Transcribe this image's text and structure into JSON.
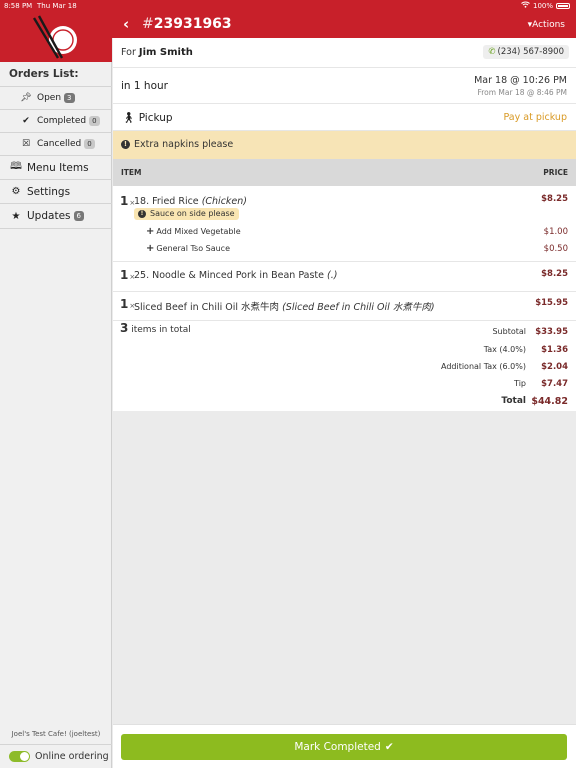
{
  "status_bar": {
    "time": "8:58 PM",
    "date": "Thu Mar 18",
    "battery": "100%"
  },
  "sidebar": {
    "orders_title": "Orders List:",
    "open": {
      "label": "Open",
      "count": "3"
    },
    "completed": {
      "label": "Completed",
      "count": "0"
    },
    "cancelled": {
      "label": "Cancelled",
      "count": "0"
    },
    "menu_items": "Menu Items",
    "settings": "Settings",
    "updates": {
      "label": "Updates",
      "count": "6"
    },
    "cafe_name": "Joel's Test Cafe! (joeltest)",
    "online_ordering": "Online ordering"
  },
  "header": {
    "order_prefix": "#",
    "order_number": "23931963",
    "actions": "Actions"
  },
  "order": {
    "for_prefix": "For",
    "customer": "Jim Smith",
    "phone": "(234) 567-8900",
    "eta": "in 1 hour",
    "date": "Mar 18 @ 10:26 PM",
    "date_from": "From Mar 18 @ 8:46 PM",
    "mode": "Pickup",
    "payment": "Pay at pickup",
    "note": "Extra napkins please"
  },
  "table_header": {
    "item": "ITEM",
    "price": "PRICE"
  },
  "items": [
    {
      "qty": "1",
      "x": "×",
      "name": "18. Fried Rice",
      "variant": "(Chicken)",
      "price": "$8.25",
      "note": "Sauce on side please",
      "modifiers": [
        {
          "plus": "+",
          "name": "Add Mixed Vegetable",
          "price": "$1.00"
        },
        {
          "plus": "+",
          "name": "General Tso Sauce",
          "price": "$0.50"
        }
      ]
    },
    {
      "qty": "1",
      "x": "×",
      "name": "25. Noodle & Minced Pork in Bean Paste",
      "variant": "(.)",
      "price": "$8.25"
    },
    {
      "qty": "1",
      "x": "×",
      "name": "Sliced Beef in Chili Oil 水煮牛肉",
      "variant": "(Sliced Beef in Chili Oil 水煮牛肉)",
      "price": "$15.95"
    }
  ],
  "totals": {
    "count": "3",
    "count_label": "items in total",
    "subtotal_label": "Subtotal",
    "subtotal": "$33.95",
    "tax_label": "Tax (4.0%)",
    "tax": "$1.36",
    "add_tax_label": "Additional Tax (6.0%)",
    "add_tax": "$2.04",
    "tip_label": "Tip",
    "tip": "$7.47",
    "total_label": "Total",
    "total": "$44.82"
  },
  "footer": {
    "mark_completed": "Mark Completed"
  }
}
